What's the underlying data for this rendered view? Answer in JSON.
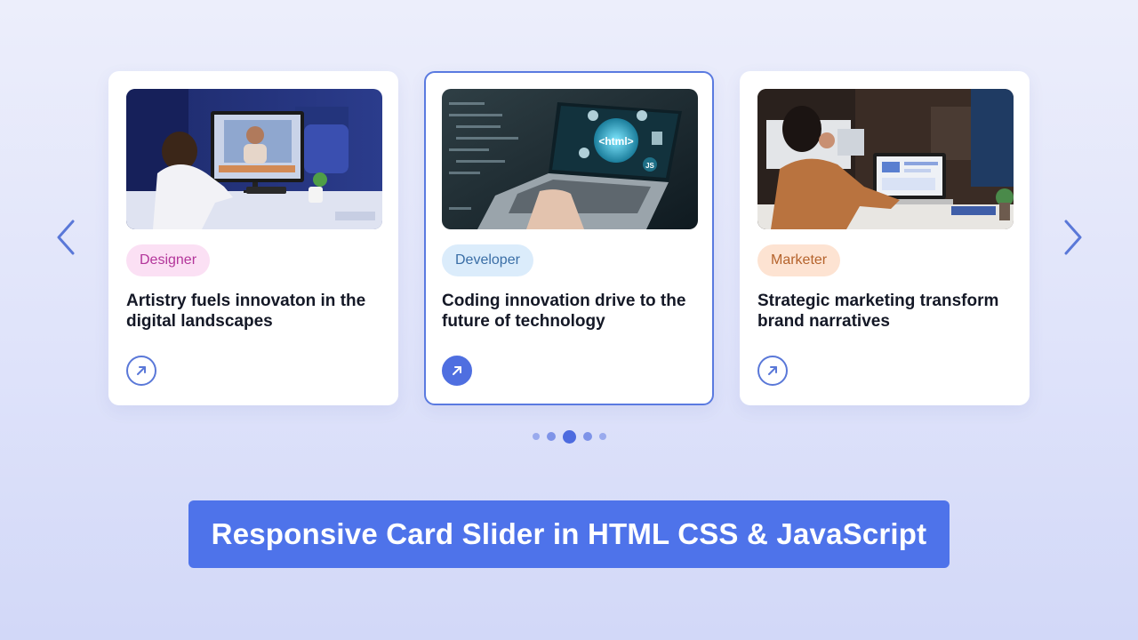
{
  "slider": {
    "cards": [
      {
        "category": "Designer",
        "title": "Artistry fuels innovaton in the digital landscapes",
        "image_icon": "designer-workspace-photo",
        "link_icon": "arrow-up-right-icon"
      },
      {
        "category": "Developer",
        "title": "Coding innovation drive to the future of technology",
        "image_icon": "laptop-html-photo",
        "link_icon": "arrow-up-right-icon",
        "image_text": "<html>",
        "image_badge": "JS"
      },
      {
        "category": "Marketer",
        "title": "Strategic marketing transform brand narratives",
        "image_icon": "marketer-office-photo",
        "link_icon": "arrow-up-right-icon"
      }
    ],
    "prev_icon": "chevron-left-icon",
    "next_icon": "chevron-right-icon",
    "pagination": {
      "total": 5,
      "active_index": 2
    }
  },
  "banner": {
    "text": "Responsive Card Slider in HTML CSS & JavaScript"
  },
  "colors": {
    "accent": "#4e73ea",
    "active_border": "#5a7ae0",
    "designer_badge_bg": "#fbe0f4",
    "designer_badge_text": "#b3359a",
    "developer_badge_bg": "#dbecfb",
    "developer_badge_text": "#3a6ea6",
    "marketer_badge_bg": "#fde3d2",
    "marketer_badge_text": "#b5632c"
  }
}
